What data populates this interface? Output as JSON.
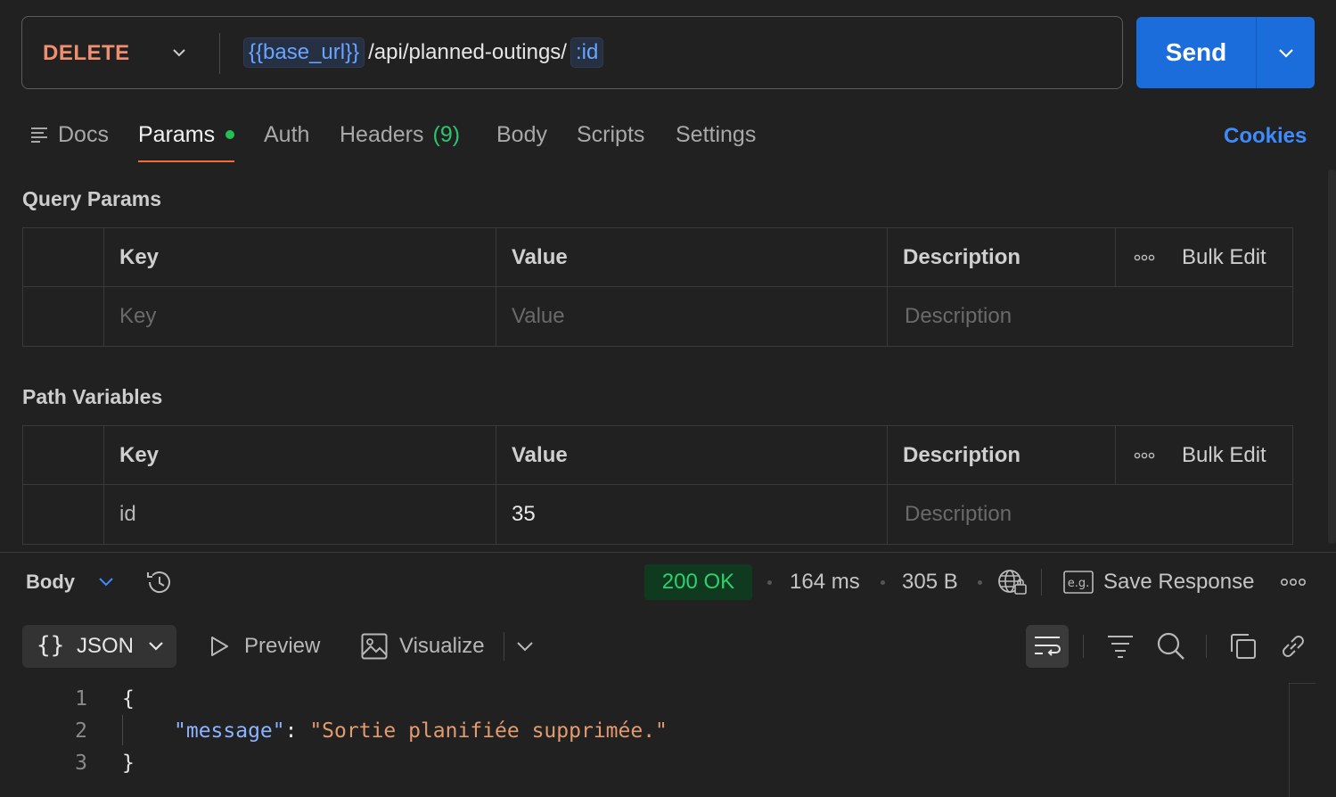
{
  "request": {
    "method": "DELETE",
    "url_var": "{{base_url}}",
    "url_path": "/api/planned-outings/",
    "url_param": ":id",
    "send_label": "Send"
  },
  "tabs": {
    "docs": "Docs",
    "params": "Params",
    "auth": "Auth",
    "headers": "Headers",
    "headers_count": "(9)",
    "body": "Body",
    "scripts": "Scripts",
    "settings": "Settings",
    "cookies": "Cookies"
  },
  "query_params": {
    "title": "Query Params",
    "headers": {
      "key": "Key",
      "value": "Value",
      "description": "Description",
      "bulk_edit": "Bulk Edit"
    },
    "placeholder": {
      "key": "Key",
      "value": "Value",
      "description": "Description"
    }
  },
  "path_variables": {
    "title": "Path Variables",
    "headers": {
      "key": "Key",
      "value": "Value",
      "description": "Description",
      "bulk_edit": "Bulk Edit"
    },
    "rows": [
      {
        "key": "id",
        "value": "35",
        "description_placeholder": "Description"
      }
    ]
  },
  "response": {
    "body_label": "Body",
    "status": "200 OK",
    "time": "164 ms",
    "size": "305 B",
    "save_response": "Save Response",
    "format": "JSON",
    "preview": "Preview",
    "visualize": "Visualize",
    "status_color": "#2fd06b"
  },
  "code": {
    "line_numbers": [
      "1",
      "2",
      "3"
    ],
    "open_brace": "{",
    "key": "\"message\"",
    "colon": ": ",
    "value": "\"Sortie planifiée supprimée.\"",
    "close_brace": "}"
  },
  "colors": {
    "accent": "#1c6ddc",
    "method": "#f08e70",
    "tab_underline": "#f26b3a",
    "cookies": "#3d8bfd"
  }
}
